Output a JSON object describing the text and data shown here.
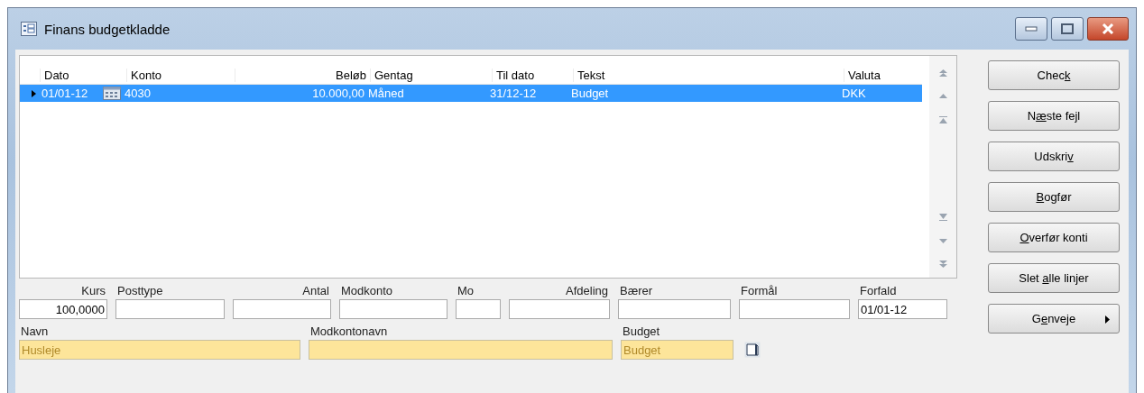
{
  "window": {
    "title": "Finans budgetkladde"
  },
  "table": {
    "columns": [
      {
        "label": "Dato"
      },
      {
        "label": "Konto"
      },
      {
        "label": "Beløb"
      },
      {
        "label": "Gentag"
      },
      {
        "label": "Til dato"
      },
      {
        "label": "Tekst"
      },
      {
        "label": "Valuta"
      }
    ],
    "rows": [
      {
        "selected": true,
        "cells": [
          "01/01-12",
          "4030",
          "10.000,00",
          "Måned",
          "31/12-12",
          "Budget",
          "DKK"
        ]
      }
    ]
  },
  "buttons": [
    {
      "before": "Chec",
      "accel": "k",
      "submenu": false
    },
    {
      "before": "N",
      "accel": "æ",
      "after": "ste fejl",
      "submenu": false
    },
    {
      "before": "Udskri",
      "accel": "v",
      "submenu": false
    },
    {
      "accel": "B",
      "after": "ogfør",
      "submenu": false
    },
    {
      "accel": "O",
      "after": "verfør konti",
      "submenu": false
    },
    {
      "before": "Slet ",
      "accel": "a",
      "after": "lle linjer",
      "submenu": false
    },
    {
      "before": "G",
      "accel": "e",
      "after": "nveje",
      "submenu": true
    }
  ],
  "fields": [
    {
      "label": "Kurs",
      "value": "100,0000"
    },
    {
      "label": "Posttype"
    },
    {
      "label": "Antal"
    },
    {
      "label": "Modkonto"
    },
    {
      "label": "Mo"
    },
    {
      "label": "Afdeling"
    },
    {
      "label": "Bærer"
    },
    {
      "label": "Formål"
    },
    {
      "label": "Forfald",
      "value": "01/01-12"
    }
  ],
  "info_fields": [
    {
      "label": "Navn",
      "value": "Husleje"
    },
    {
      "label": "Modkontonavn"
    },
    {
      "label": "Budget",
      "value": "Budget"
    }
  ]
}
